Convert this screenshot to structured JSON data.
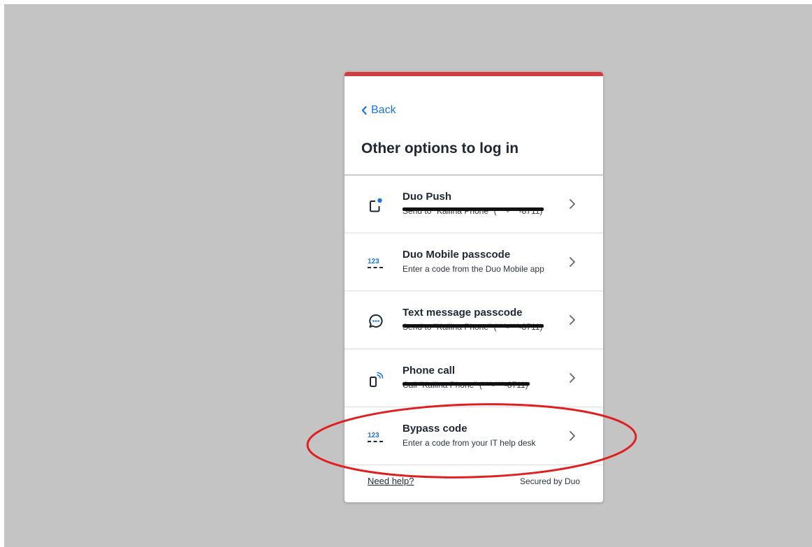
{
  "colors": {
    "accent_bar": "#d53a3f",
    "link": "#1a73e8",
    "annotation": "#e02020",
    "backdrop": "#c4c4c4"
  },
  "back": {
    "label": "Back",
    "icon": "chevron-left-icon"
  },
  "title": "Other options to log in",
  "options": [
    {
      "title": "Duo Push",
      "subtitle": "Send to \"Kallina Phone\" (***-***-8711)",
      "icon": "phone-notification-icon",
      "redacted": true
    },
    {
      "title": "Duo Mobile passcode",
      "subtitle": "Enter a code from the Duo Mobile app",
      "icon": "passcode-123-icon",
      "redacted": false
    },
    {
      "title": "Text message passcode",
      "subtitle": "Send to \"Kallina Phone\" (***-***-8711)",
      "icon": "chat-bubble-icon",
      "redacted": true
    },
    {
      "title": "Phone call",
      "subtitle": "Call \"Kallina Phone\" (***-***-8711)",
      "icon": "phone-call-icon",
      "redacted": true
    },
    {
      "title": "Bypass code",
      "subtitle": "Enter a code from your IT help desk",
      "icon": "passcode-123-icon",
      "redacted": false
    }
  ],
  "footer": {
    "help": "Need help?",
    "secured": "Secured by Duo"
  },
  "icons": {
    "digits": "123"
  }
}
